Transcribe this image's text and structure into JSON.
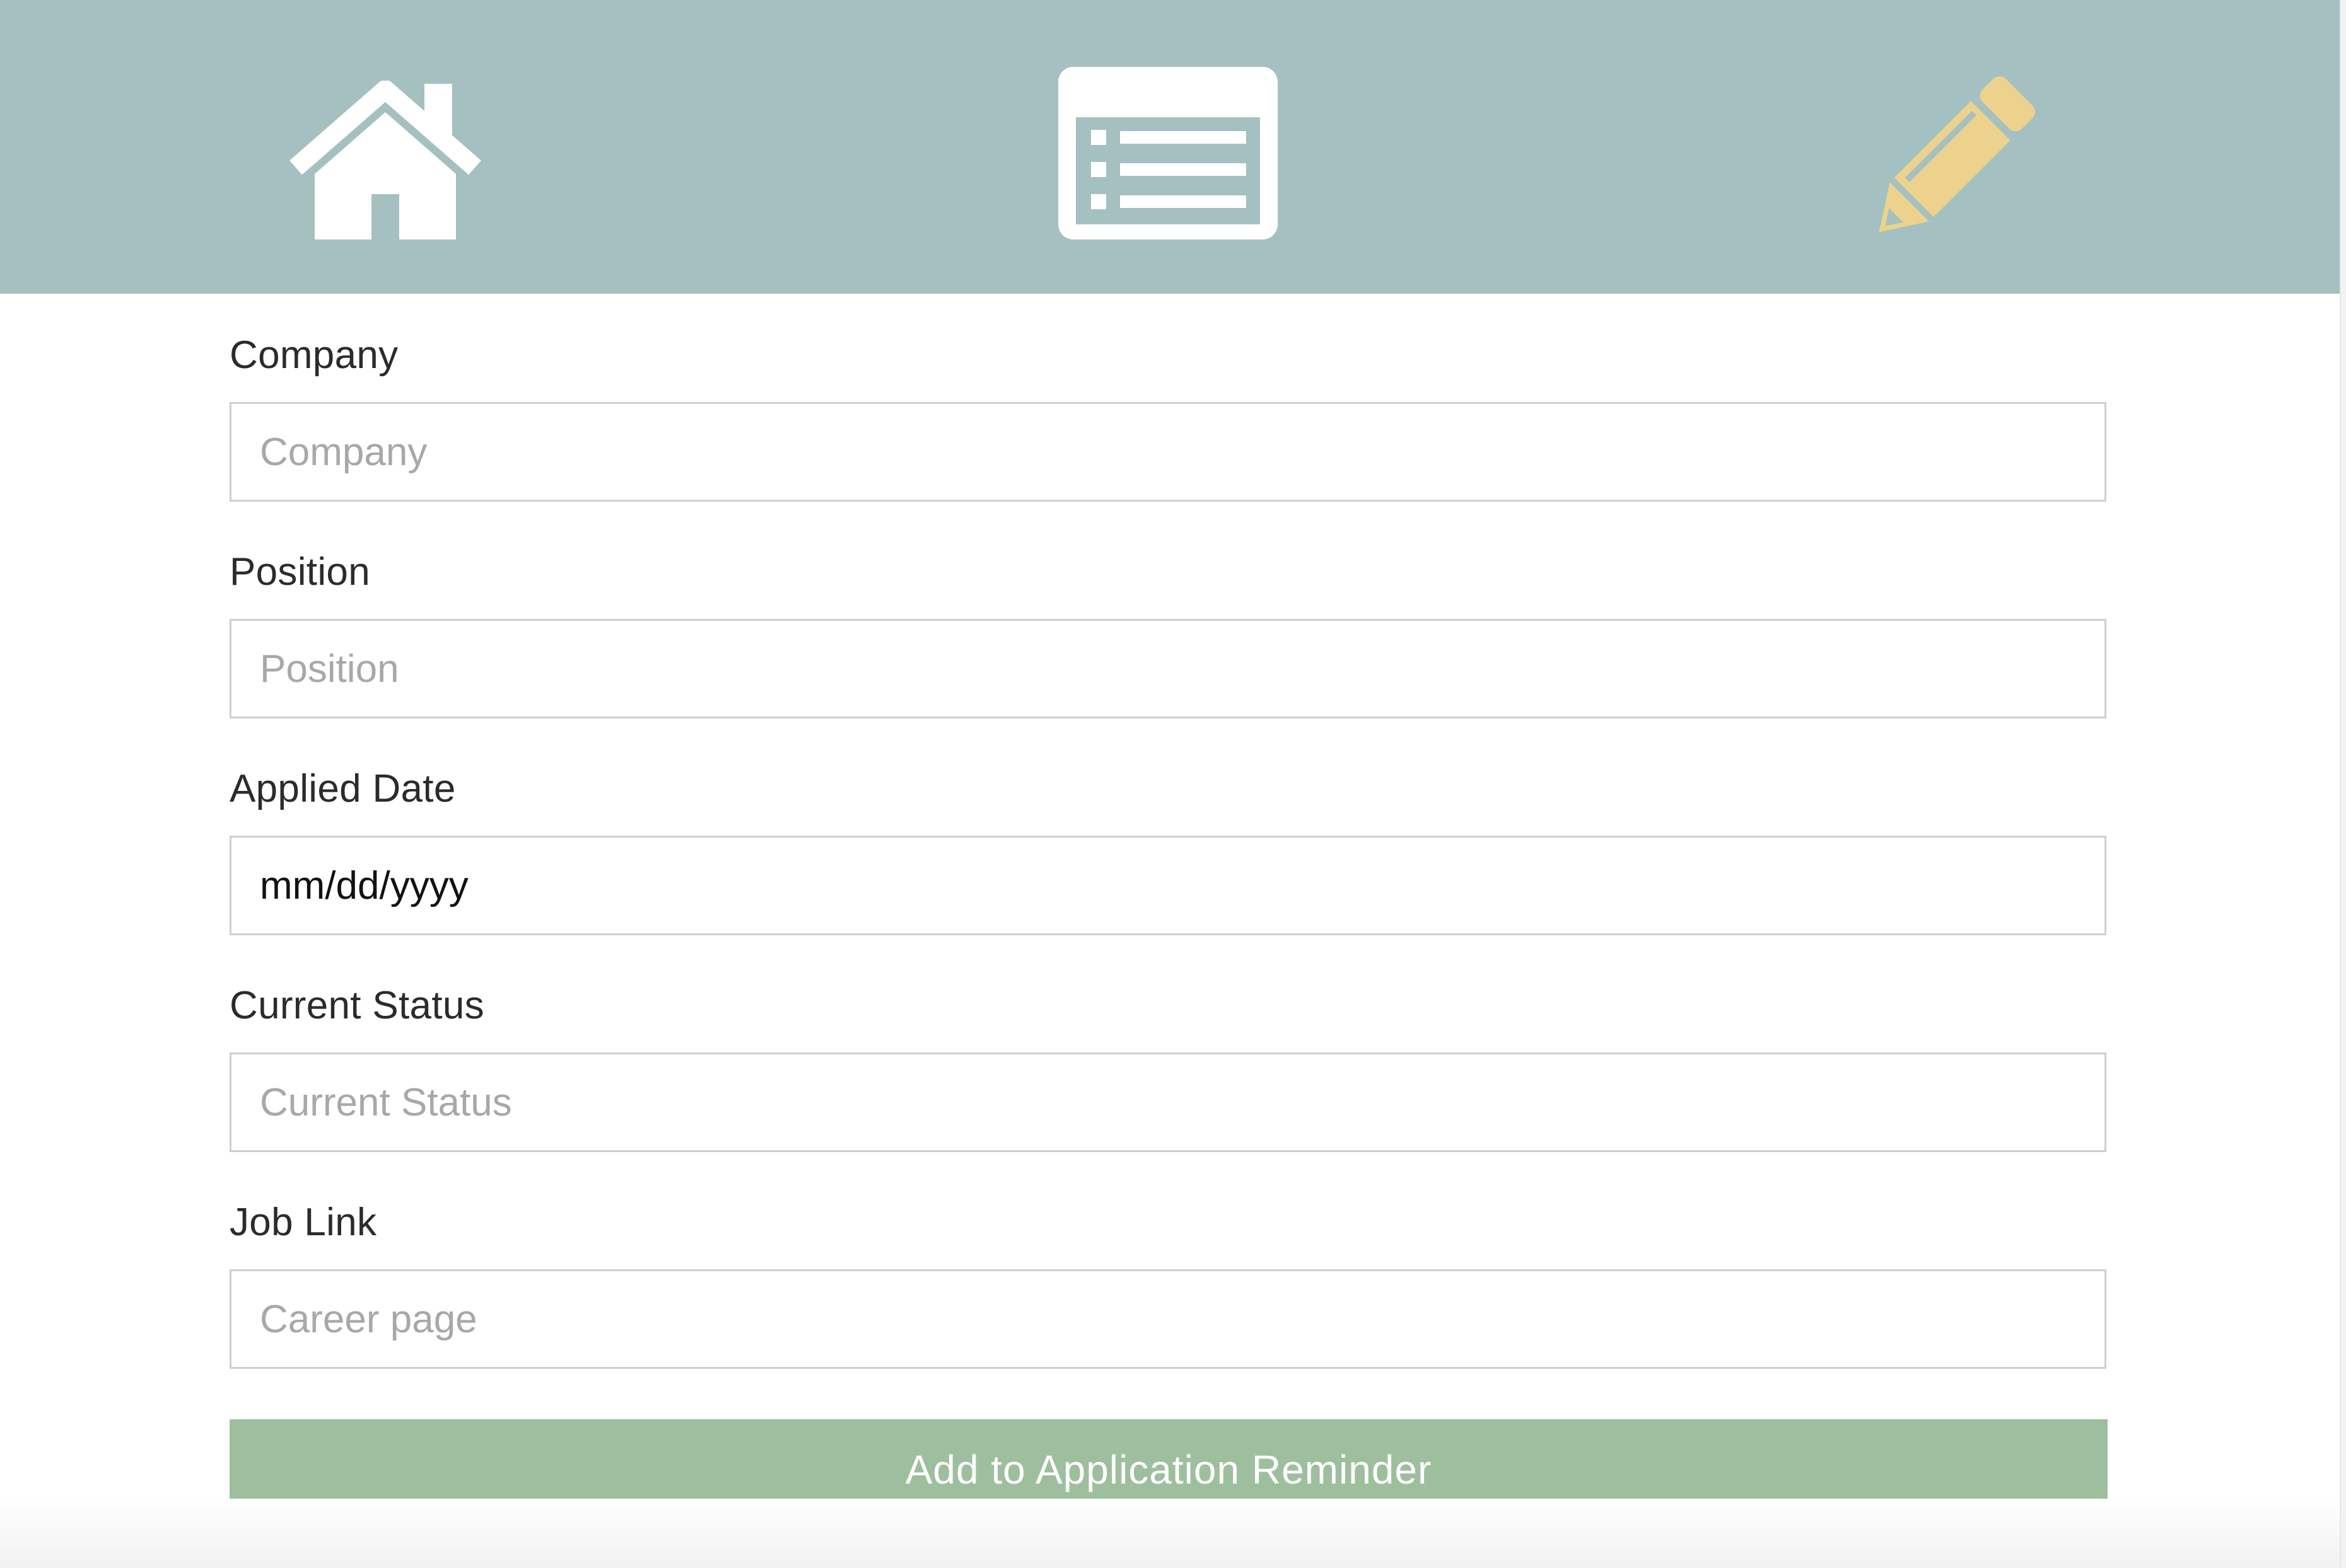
{
  "colors": {
    "navbar_bg": "#a5c0c0",
    "home_icon": "#ffffff",
    "list_icon": "#ffffff",
    "edit_icon_active": "#ecd28c",
    "submit_bg": "#9ebf9d",
    "submit_text": "#ffffff",
    "input_border": "#cfcfcf",
    "placeholder": "#a8a8a8"
  },
  "nav": {
    "items": [
      {
        "icon": "home-icon"
      },
      {
        "icon": "list-icon"
      },
      {
        "icon": "pencil-icon",
        "active": true
      }
    ]
  },
  "form": {
    "company": {
      "label": "Company",
      "placeholder": "Company"
    },
    "position": {
      "label": "Position",
      "placeholder": "Position"
    },
    "applied_date": {
      "label": "Applied Date",
      "placeholder": "mm/dd/yyyy"
    },
    "current_status": {
      "label": "Current Status",
      "placeholder": "Current Status"
    },
    "job_link": {
      "label": "Job Link",
      "placeholder": "Career page"
    },
    "submit_label": "Add to Application Reminder"
  }
}
